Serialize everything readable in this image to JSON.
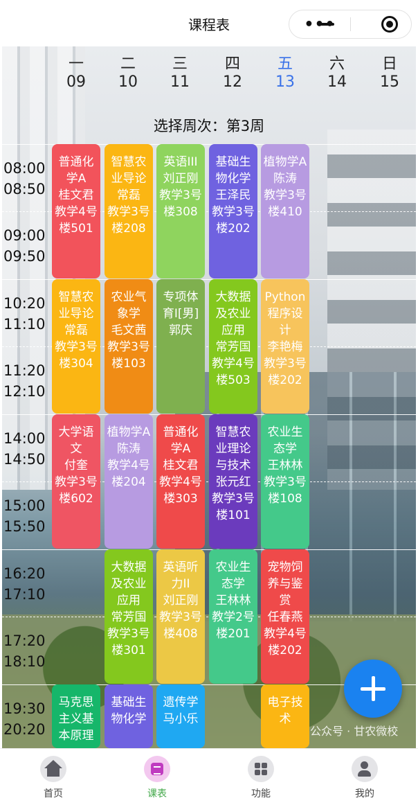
{
  "header": {
    "title": "课程表"
  },
  "days": [
    {
      "name": "一",
      "date": "09"
    },
    {
      "name": "二",
      "date": "10"
    },
    {
      "name": "三",
      "date": "11"
    },
    {
      "name": "四",
      "date": "12"
    },
    {
      "name": "五",
      "date": "13",
      "today": true
    },
    {
      "name": "六",
      "date": "14"
    },
    {
      "name": "日",
      "date": "15"
    }
  ],
  "week_selector": "选择周次：第3周",
  "times": [
    "08:00",
    "08:50",
    "09:00",
    "09:50",
    "10:20",
    "11:10",
    "11:20",
    "12:10",
    "14:00",
    "14:50",
    "15:00",
    "15:50",
    "16:20",
    "17:10",
    "17:20",
    "18:10",
    "19:30",
    "20:20"
  ],
  "courses": [
    {
      "day": 0,
      "block": 0,
      "text": "普通化学A\n桂文君\n教学4号楼501",
      "color": "#f2535b"
    },
    {
      "day": 1,
      "block": 0,
      "text": "智慧农业导论\n常磊\n教学3号楼208",
      "color": "#fbb613"
    },
    {
      "day": 2,
      "block": 0,
      "text": "英语III\n刘正刚\n教学3号楼308",
      "color": "#8fd45e"
    },
    {
      "day": 3,
      "block": 0,
      "text": "基础生物化学\n王泽民\n教学3号楼202",
      "color": "#6f62e0"
    },
    {
      "day": 4,
      "block": 0,
      "text": "植物学A\n陈涛\n教学3号楼410",
      "color": "#b79be1"
    },
    {
      "day": 0,
      "block": 1,
      "text": "智慧农业导论\n常磊\n教学3号楼304",
      "color": "#fbb613"
    },
    {
      "day": 1,
      "block": 1,
      "text": "农业气象学\n毛文茜\n教学3号楼103",
      "color": "#f08c15"
    },
    {
      "day": 2,
      "block": 1,
      "text": "专项体育Ⅰ[男]\n郭庆",
      "color": "#7fb04f"
    },
    {
      "day": 3,
      "block": 1,
      "text": "大数据及农业应用\n常芳国\n教学4号楼503",
      "color": "#84c81e"
    },
    {
      "day": 4,
      "block": 1,
      "text": "Python程序设计\n李艳梅\n教学3号楼202",
      "color": "#f7c45c"
    },
    {
      "day": 0,
      "block": 2,
      "text": "大学语文\n付奎\n教学3号楼602",
      "color": "#ef5563"
    },
    {
      "day": 1,
      "block": 2,
      "text": "植物学A\n陈涛\n教学4号楼204",
      "color": "#b79be1"
    },
    {
      "day": 2,
      "block": 2,
      "text": "普通化学A\n桂文君\n教学4号楼303",
      "color": "#ef4a4a"
    },
    {
      "day": 3,
      "block": 2,
      "text": "智慧农业理论与技术\n张元红\n教学3号楼101",
      "color": "#6b3bbd"
    },
    {
      "day": 4,
      "block": 2,
      "text": "农业生态学\n王林林\n教学3号楼108",
      "color": "#44c98a"
    },
    {
      "day": 1,
      "block": 3,
      "text": "大数据及农业应用\n常芳国\n教学3号楼301",
      "color": "#84c81e"
    },
    {
      "day": 2,
      "block": 3,
      "text": "英语听力II\n刘正刚\n教学3号楼408",
      "color": "#ecc845"
    },
    {
      "day": 3,
      "block": 3,
      "text": "农业生态学\n王林林\n教学2号楼201",
      "color": "#44c98a"
    },
    {
      "day": 4,
      "block": 3,
      "text": "宠物饲养与鉴赏\n任春燕\n教学4号楼202",
      "color": "#ef4a4a"
    },
    {
      "day": 0,
      "block": 4,
      "text": "马克思主义基本原理",
      "color": "#16b66a"
    },
    {
      "day": 1,
      "block": 4,
      "text": "基础生物化学",
      "color": "#6f62e0"
    },
    {
      "day": 2,
      "block": 4,
      "text": "遗传学\n马小乐",
      "color": "#1fa8f2"
    },
    {
      "day": 4,
      "block": 4,
      "text": "电子技术",
      "color": "#fbb613"
    }
  ],
  "watermark": "公众号 · 甘农微校",
  "tabs": [
    {
      "label": "首页",
      "icon": "home-icon"
    },
    {
      "label": "课表",
      "icon": "schedule-icon",
      "active": true
    },
    {
      "label": "功能",
      "icon": "grid-icon"
    },
    {
      "label": "我的",
      "icon": "profile-icon"
    }
  ]
}
